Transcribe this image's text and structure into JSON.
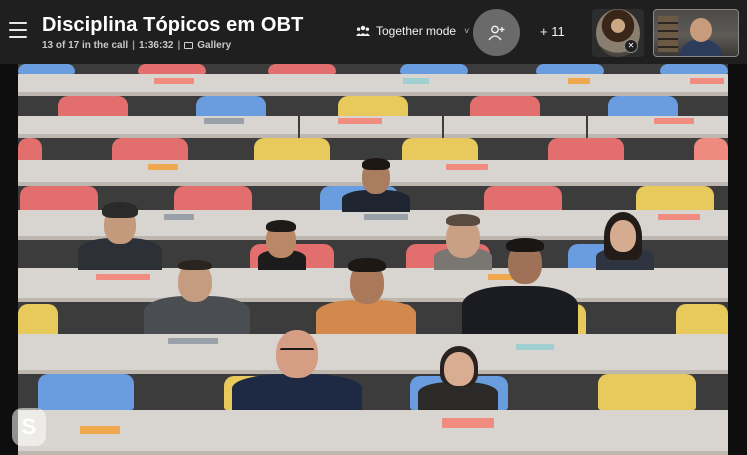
{
  "header": {
    "title": "Disciplina Tópicos em OBT",
    "participants_status": "13 of 17 in the call",
    "duration": "1:36:32",
    "separator": "|",
    "view_label": "Gallery",
    "mode_label": "Together mode",
    "overflow_count": "+ 11"
  },
  "icons": {
    "menu": "hamburger-icon",
    "gallery": "gallery-icon",
    "together_mode": "people-group-icon",
    "add_people": "add-person-icon",
    "muted": "mic-off-icon",
    "app_logo": "skype-logo"
  },
  "stage": {
    "logo_letter": "S"
  },
  "colors": {
    "topbar": "#1f1f1f",
    "add_button": "#6a6a6a",
    "seat_red": "#e26e6e",
    "seat_blue": "#6a9ce0",
    "seat_yellow": "#e8ca5c",
    "desk": "#d8d4cf"
  }
}
